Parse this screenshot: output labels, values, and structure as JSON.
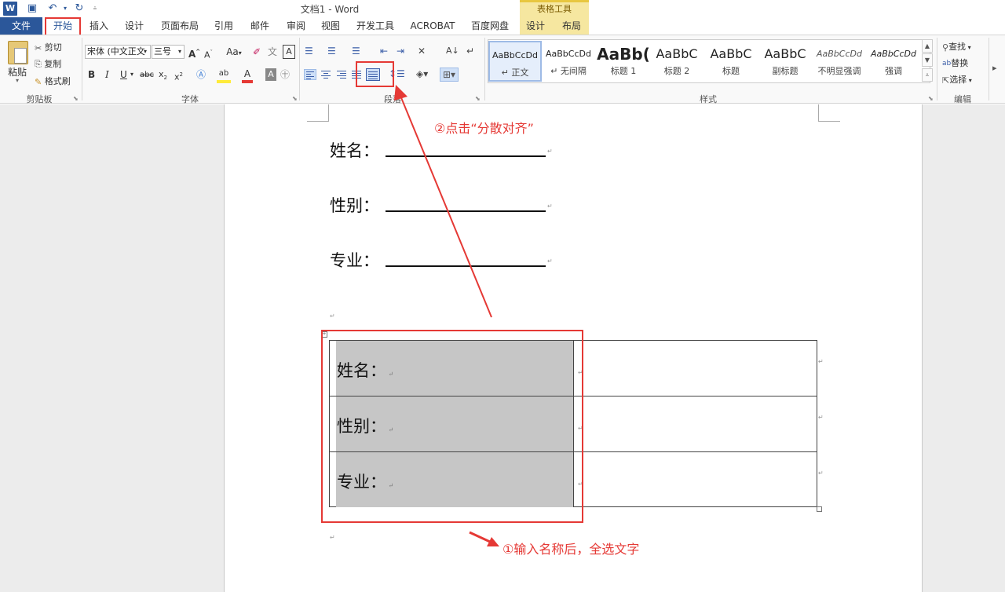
{
  "titlebar": {
    "title": "文档1 - Word",
    "table_tools": "表格工具"
  },
  "tabs": [
    "文件",
    "开始",
    "插入",
    "设计",
    "页面布局",
    "引用",
    "邮件",
    "审阅",
    "视图",
    "开发工具",
    "ACROBAT",
    "百度网盘",
    "设计",
    "布局"
  ],
  "clipboard": {
    "paste": "粘贴",
    "cut": "剪切",
    "copy": "复制",
    "format_painter": "格式刷",
    "group": "剪贴板"
  },
  "font": {
    "font_name": "宋体 (中文正文",
    "font_size": "三号",
    "case_button": "Aa",
    "group": "字体"
  },
  "paragraph": {
    "group": "段落"
  },
  "styles": {
    "group": "样式",
    "items": [
      {
        "preview": "AaBbCcDd",
        "name": "↵ 正文"
      },
      {
        "preview": "AaBbCcDd",
        "name": "↵ 无间隔"
      },
      {
        "preview": "AaBb(",
        "name": "标题 1"
      },
      {
        "preview": "AaBbC",
        "name": "标题 2"
      },
      {
        "preview": "AaBbC",
        "name": "标题"
      },
      {
        "preview": "AaBbC",
        "name": "副标题"
      },
      {
        "preview": "AaBbCcDd",
        "name": "不明显强调"
      },
      {
        "preview": "AaBbCcDd",
        "name": "强调"
      }
    ]
  },
  "editing": {
    "find": "查找",
    "replace": "替换",
    "select": "选择",
    "group": "编辑"
  },
  "document": {
    "fields": [
      "姓名：",
      "性别：",
      "专业："
    ],
    "table_rows": [
      "姓名：",
      "性别：",
      "专业："
    ]
  },
  "annotations": {
    "step2": "②点击“分散对齐”",
    "step1": "①输入名称后，全选文字"
  },
  "colors": {
    "accent": "#2b579a",
    "annotation": "#e53935",
    "table_tools": "#f6e7a0",
    "selection": "#c6c6c6"
  }
}
